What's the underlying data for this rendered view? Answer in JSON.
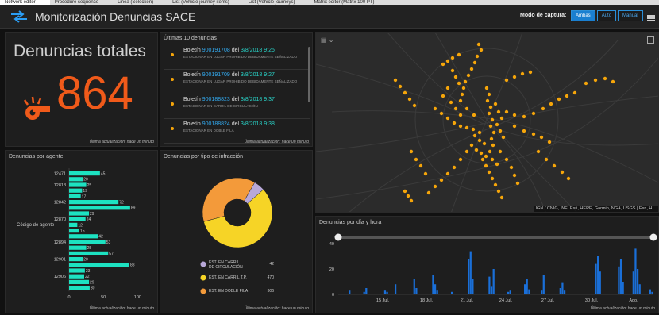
{
  "tabs": [
    "Network editor",
    "Procedure sequence",
    "Linea (Selecken)",
    "List (Vehicle journey items)",
    "List (Vehicle journeys)",
    "Matrix editor (Matrix 100 PT)"
  ],
  "header": {
    "title": "Monitorización Denuncias SACE",
    "mode_label": "Modo de captura:",
    "modes": [
      "Ambas",
      "Auto",
      "Manual"
    ],
    "active_mode": "Ambas"
  },
  "colors": {
    "accent": "#1a7fd0",
    "orange": "#f05a1a",
    "points": "#f5a50a",
    "teal": "#1de2c1"
  },
  "total": {
    "title": "Denuncias totales",
    "value": "864",
    "footer": "Última actualización: hace un minuto"
  },
  "last10": {
    "title": "Últimas 10 denuncias",
    "footer": "Última actualización: hace un minuto",
    "items": [
      {
        "prefix": "Boletín",
        "id": "900191708",
        "mid": "del",
        "date": "3/8/2018 9:25",
        "desc": "ESTACIONAR EN LUGAR PROHIBIDO DEBIDAMENTE SEÑALIZADO"
      },
      {
        "prefix": "Boletín",
        "id": "900191709",
        "mid": "del",
        "date": "3/8/2018 9:27",
        "desc": "ESTACIONAR EN LUGAR PROHIBIDO DEBIDAMENTE SEÑALIZADO"
      },
      {
        "prefix": "Boletín",
        "id": "900188823",
        "mid": "del",
        "date": "3/8/2018 9:37",
        "desc": "ESTACIONAR EN CARRIL DE CIRCULACIÓN"
      },
      {
        "prefix": "Boletín",
        "id": "900188824",
        "mid": "del",
        "date": "3/8/2018 9:38",
        "desc": "ESTACIONAR EN DOBLE FILA"
      }
    ]
  },
  "agents": {
    "title": "Denuncias por agente",
    "footer": "Última actualización: hace un minuto",
    "chart_data": {
      "type": "bar",
      "orientation": "horizontal",
      "ylabel": "Código de agente",
      "categories": [
        "12471",
        "",
        "12818",
        "",
        "",
        "12842",
        "",
        "",
        "12870",
        "",
        "",
        "",
        "12894",
        "",
        "",
        "12901",
        "",
        "",
        "12906",
        "",
        ""
      ],
      "values": [
        45,
        20,
        25,
        19,
        17,
        72,
        89,
        29,
        24,
        12,
        15,
        42,
        53,
        25,
        57,
        20,
        88,
        23,
        22,
        29,
        30
      ],
      "xticks": [
        "0",
        "50",
        "100"
      ],
      "xlim": [
        0,
        110
      ]
    }
  },
  "types": {
    "title": "Denuncias por tipo de infracción",
    "footer": "Última actualización: hace un minuto",
    "chart_data": {
      "type": "pie",
      "donut": true,
      "series": [
        {
          "name": "EST. EN CARRIL DE CIRCULACIÓN",
          "value": 42,
          "color": "#b8a8d8"
        },
        {
          "name": "EST. EN CARRIL T.P.",
          "value": 470,
          "color": "#f6d426"
        },
        {
          "name": "EST. EN DOBLE FILA",
          "value": 306,
          "color": "#f39a3a"
        }
      ]
    }
  },
  "map": {
    "attribution": "IGN / CNIG, INE, Esri, HERE, Garmin, NGA, USGS | Esri, H...",
    "tool_icons": [
      "bookmark-icon",
      "chevron-down-icon"
    ]
  },
  "timeline": {
    "title": "Denuncias por día y hora",
    "footer": "Última actualización: hace un minuto",
    "chart_data": {
      "type": "bar",
      "ylim": [
        0,
        45
      ],
      "yticks": [
        "40",
        "20",
        "0"
      ],
      "xticks": [
        "15 Jul.",
        "18 Jul.",
        "21 Jul.",
        "24 Jul.",
        "27 Jul.",
        "30 Jul.",
        "Ago."
      ],
      "values": [
        0,
        0,
        0,
        0,
        0,
        3,
        0,
        0,
        0,
        0,
        0,
        0,
        2,
        5,
        0,
        0,
        0,
        0,
        0,
        0,
        0,
        0,
        3,
        2,
        0,
        0,
        0,
        8,
        0,
        0,
        0,
        0,
        0,
        0,
        0,
        0,
        12,
        5,
        0,
        0,
        0,
        0,
        0,
        0,
        0,
        15,
        8,
        3,
        0,
        0,
        0,
        0,
        0,
        0,
        2,
        0,
        0,
        0,
        0,
        0,
        0,
        0,
        28,
        34,
        12,
        0,
        0,
        0,
        0,
        0,
        0,
        0,
        14,
        6,
        20,
        0,
        0,
        0,
        0,
        0,
        0,
        2,
        3,
        0,
        0,
        0,
        0,
        0,
        0,
        8,
        12,
        4,
        0,
        0,
        0,
        0,
        0,
        3,
        15,
        0,
        0,
        0,
        0,
        0,
        0,
        0,
        5,
        9,
        3,
        0,
        0,
        0,
        0,
        0,
        0,
        0,
        0,
        0,
        0,
        0,
        0,
        0,
        0,
        24,
        30,
        18,
        0,
        0,
        0,
        0,
        0,
        0,
        0,
        0,
        22,
        28,
        10,
        0,
        0,
        0,
        0,
        18,
        36,
        20,
        8,
        0,
        0,
        0,
        0,
        4,
        2
      ],
      "color": "#1a6fd8"
    }
  }
}
